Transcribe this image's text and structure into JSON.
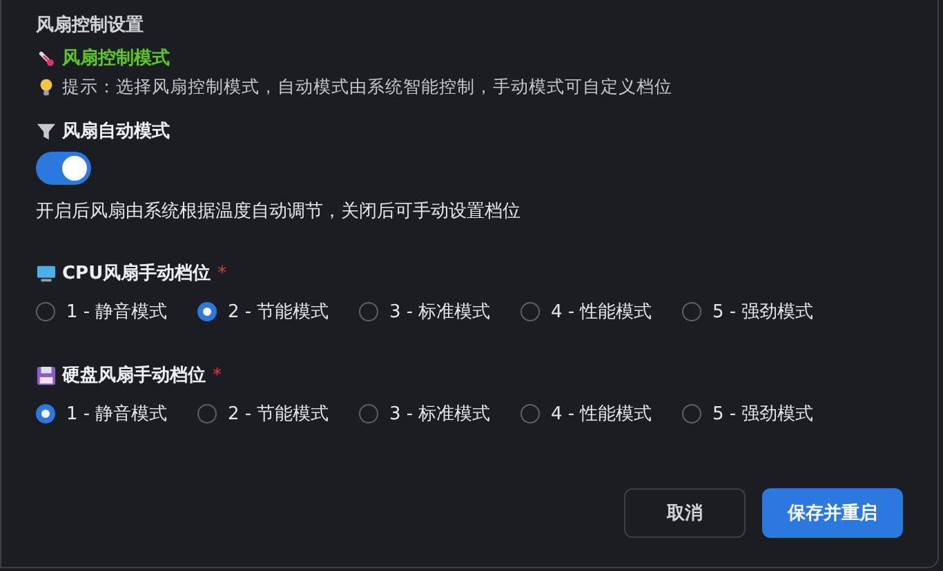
{
  "section_title": "风扇控制设置",
  "mode_label": "风扇控制模式",
  "tip": "提示：选择风扇控制模式，自动模式由系统智能控制，手动模式可自定义档位",
  "auto_mode": {
    "label": "风扇自动模式",
    "on": true,
    "description": "开启后风扇由系统根据温度自动调节，关闭后可手动设置档位"
  },
  "groups": [
    {
      "kind": "cpu",
      "label": "CPU风扇手动档位",
      "required": "*",
      "options": [
        {
          "label": "1 - 静音模式",
          "selected": false
        },
        {
          "label": "2 - 节能模式",
          "selected": true
        },
        {
          "label": "3 - 标准模式",
          "selected": false
        },
        {
          "label": "4 - 性能模式",
          "selected": false
        },
        {
          "label": "5 - 强劲模式",
          "selected": false
        }
      ]
    },
    {
      "kind": "disk",
      "label": "硬盘风扇手动档位",
      "required": "*",
      "options": [
        {
          "label": "1 - 静音模式",
          "selected": true
        },
        {
          "label": "2 - 节能模式",
          "selected": false
        },
        {
          "label": "3 - 标准模式",
          "selected": false
        },
        {
          "label": "4 - 性能模式",
          "selected": false
        },
        {
          "label": "5 - 强劲模式",
          "selected": false
        }
      ]
    }
  ],
  "buttons": {
    "cancel": "取消",
    "save": "保存并重启"
  }
}
